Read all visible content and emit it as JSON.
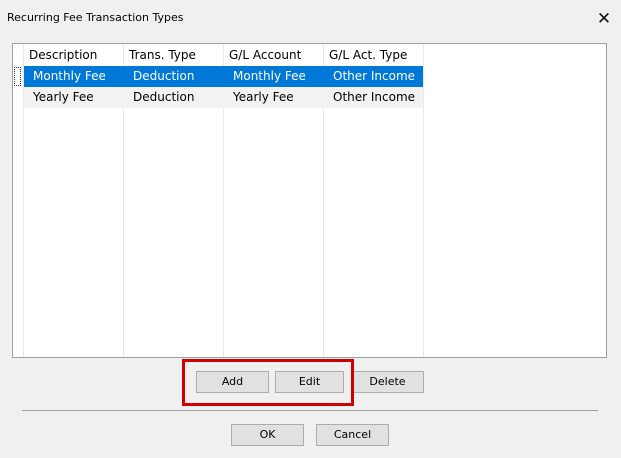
{
  "window": {
    "title": "Recurring Fee Transaction Types",
    "close_glyph": "✕"
  },
  "list": {
    "columns": [
      "Description",
      "Trans. Type",
      "G/L Account",
      "G/L Act. Type"
    ],
    "rows": [
      [
        "Monthly Fee",
        "Deduction",
        "Monthly Fee",
        "Other Income"
      ],
      [
        "Yearly Fee",
        "Deduction",
        "Yearly Fee",
        "Other Income"
      ]
    ],
    "selected_row": 0
  },
  "buttons": {
    "add": "Add",
    "edit": "Edit",
    "delete": "Delete",
    "ok": "OK",
    "cancel": "Cancel"
  },
  "colors": {
    "selection": "#0078d7",
    "annotation_highlight": "#d00000",
    "window_background": "#f0f0f0"
  }
}
